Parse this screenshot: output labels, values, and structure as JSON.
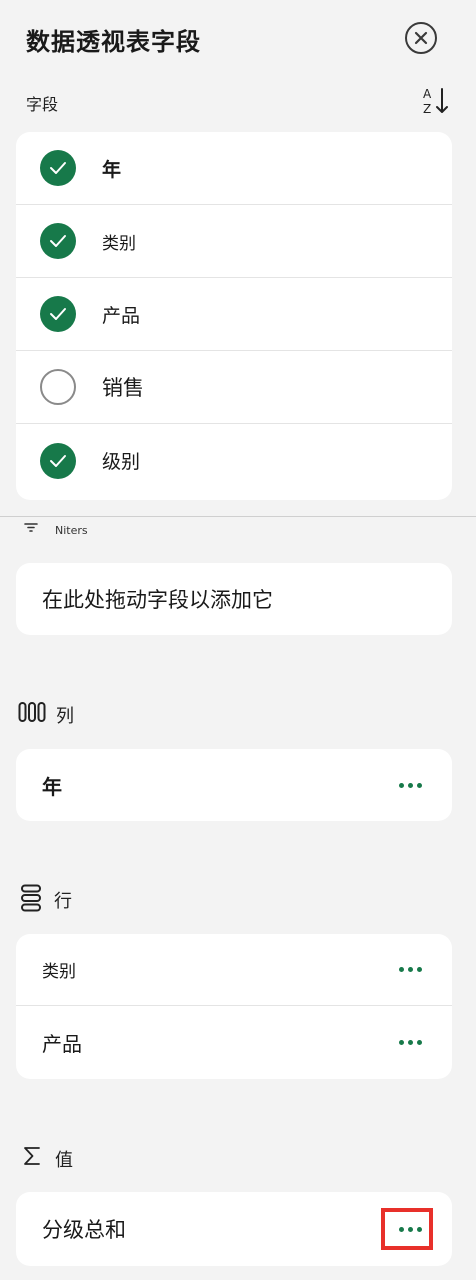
{
  "header": {
    "title": "数据透视表字段"
  },
  "fields_section": {
    "label": "字段",
    "items": [
      {
        "label": "年",
        "checked": true
      },
      {
        "label": "类别",
        "checked": true
      },
      {
        "label": "产品",
        "checked": true
      },
      {
        "label": "销售",
        "checked": false
      },
      {
        "label": "级别",
        "checked": true
      }
    ]
  },
  "filters": {
    "label": "Niters",
    "drop_hint": "在此处拖动字段以添加它"
  },
  "columns": {
    "label": "列",
    "items": [
      {
        "label": "年"
      }
    ]
  },
  "rows": {
    "label": "行",
    "items": [
      {
        "label": "类别"
      },
      {
        "label": "产品"
      }
    ]
  },
  "values": {
    "label": "值",
    "items": [
      {
        "label": "分级总和"
      }
    ]
  },
  "colors": {
    "accent": "#17794a",
    "highlight": "#e8302a"
  }
}
